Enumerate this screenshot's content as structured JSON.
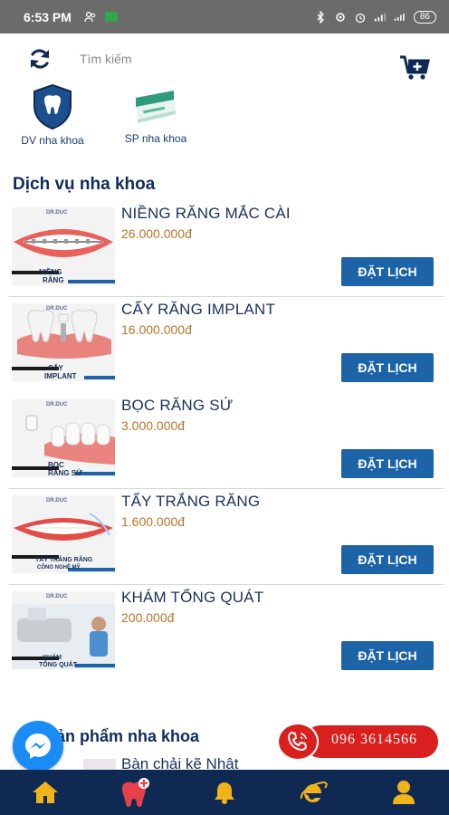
{
  "status_bar": {
    "time": "6:53 PM",
    "battery": "86"
  },
  "search": {
    "placeholder": "Tìm kiếm"
  },
  "categories": [
    {
      "label": "DV nha khoa",
      "icon": "tooth-shield-icon"
    },
    {
      "label": "SP nha khoa",
      "icon": "dental-product-icon"
    }
  ],
  "section_services_title": "Dịch vụ nha khoa",
  "services": [
    {
      "name": "NIỀNG RĂNG MẮC CÀI",
      "price": "26.000.000đ",
      "button": "ĐẶT LỊCH",
      "thumb_line1": "NIỀNG",
      "thumb_line2": "RĂNG",
      "thumb_logo": "DR.DUC"
    },
    {
      "name": "CẤY RĂNG IMPLANT",
      "price": "16.000.000đ",
      "button": "ĐẶT LỊCH",
      "thumb_line1": "CẤY",
      "thumb_line2": "IMPLANT",
      "thumb_logo": "DR.DUC"
    },
    {
      "name": "BỌC RĂNG SỨ",
      "price": "3.000.000đ",
      "button": "ĐẶT LỊCH",
      "thumb_line1": "BỌC",
      "thumb_line2": "RĂNG SỨ",
      "thumb_logo": "DR.DUC"
    },
    {
      "name": "TẨY TRẮNG RĂNG",
      "price": "1.600.000đ",
      "button": "ĐẶT LỊCH",
      "thumb_line1": "TẨY TRẮNG RĂNG",
      "thumb_line2": "CÔNG NGHỆ MỸ",
      "thumb_logo": "DR.DUC"
    },
    {
      "name": "KHÁM TỔNG QUÁT",
      "price": "200.000đ",
      "button": "ĐẶT LỊCH",
      "thumb_line1": "KHÁM",
      "thumb_line2": "TỔNG QUÁT",
      "thumb_logo": "DR.DUC"
    }
  ],
  "section_products_title": "Sản phẩm nha khoa",
  "partial_product_name": "Bàn chải kẽ Nhật",
  "hotline": "096 3614566",
  "bottom_nav": [
    {
      "icon": "home-icon"
    },
    {
      "icon": "tooth-plus-icon"
    },
    {
      "icon": "bell-icon"
    },
    {
      "icon": "browser-icon"
    },
    {
      "icon": "user-icon"
    }
  ],
  "colors": {
    "navy": "#0e2a52",
    "button_blue": "#1d63a8",
    "price": "#b5762a",
    "hotline_red": "#d9201e",
    "messenger_blue": "#1a8cf5"
  }
}
